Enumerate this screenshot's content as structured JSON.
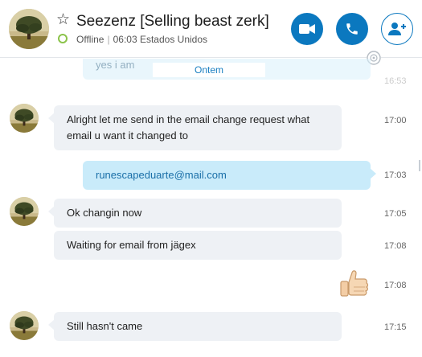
{
  "header": {
    "contact_name": "Seezenz [Selling beast zerk]",
    "status": "Offline",
    "local_time": "06:03 Estados Unidos",
    "separator": "|",
    "favorite_icon": "star-outline-icon",
    "buttons": [
      {
        "name": "video-call-button",
        "icon": "video-camera-icon"
      },
      {
        "name": "audio-call-button",
        "icon": "phone-icon"
      },
      {
        "name": "add-people-button",
        "icon": "add-person-icon"
      }
    ],
    "accent_color": "#0b78bf",
    "status_color": "#8bc34a"
  },
  "conversation": {
    "faded_message": {
      "text": "yes i am",
      "time": "16:53"
    },
    "date_separator": "Ontem",
    "messages": [
      {
        "direction": "in",
        "text": "Alright let me send in the email change request what email u want it changed to",
        "time": "17:00"
      },
      {
        "direction": "out",
        "text": "runescapeduarte@mail.com",
        "time": "17:03"
      },
      {
        "direction": "in",
        "text": "Ok changin now",
        "time": "17:05"
      },
      {
        "direction": "in",
        "text": "Waiting for email from jägex",
        "time": "17:08"
      },
      {
        "direction": "out",
        "emoji": "thumbs-up-emoticon",
        "time": "17:08"
      },
      {
        "direction": "in",
        "text": "Still hasn't came",
        "time": "17:15"
      }
    ]
  }
}
